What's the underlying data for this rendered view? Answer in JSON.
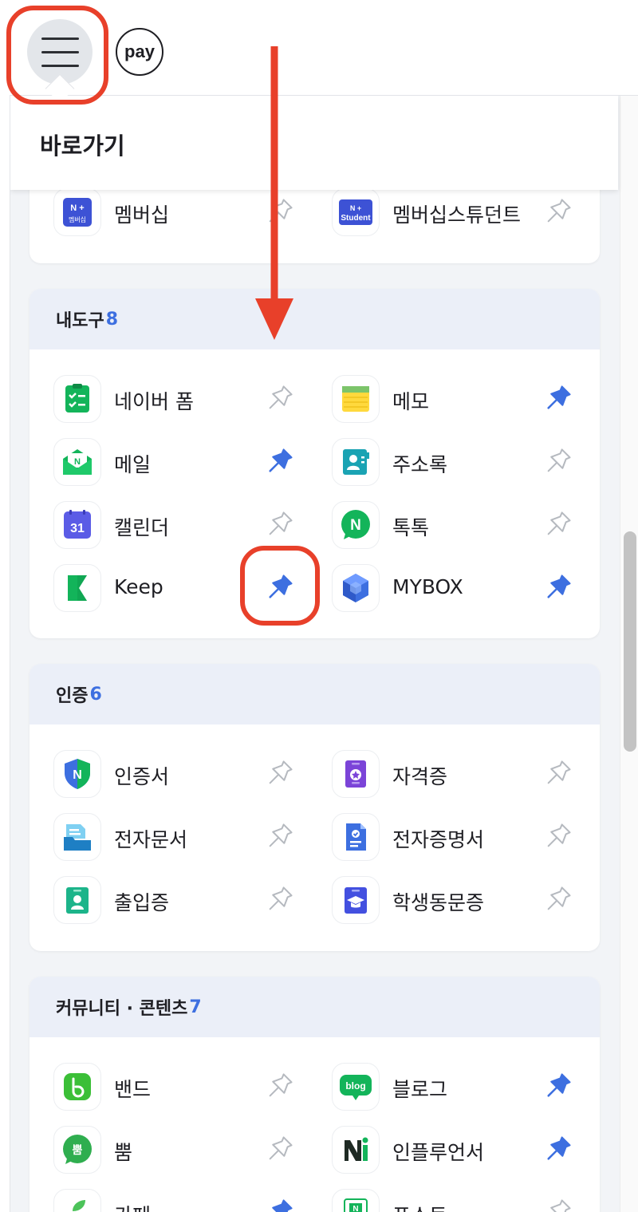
{
  "topbar": {
    "menu_icon": "hamburger-menu-icon",
    "pay_label": "pay"
  },
  "panel": {
    "title": "바로가기"
  },
  "colors": {
    "accent": "#3d6fe0",
    "highlight": "#e8402a",
    "section_bg": "#ebeff8"
  },
  "membership": {
    "items": [
      {
        "label": "멤버십",
        "icon": "membership-icon",
        "pinned": false
      },
      {
        "label": "멤버십스튜던트",
        "icon": "membership-student-icon",
        "pinned": false
      }
    ]
  },
  "tools": {
    "title": "내도구",
    "count": "8",
    "items": [
      {
        "label": "네이버 폼",
        "icon": "form-icon",
        "pinned": false
      },
      {
        "label": "메모",
        "icon": "memo-icon",
        "pinned": true
      },
      {
        "label": "메일",
        "icon": "mail-icon",
        "pinned": true
      },
      {
        "label": "주소록",
        "icon": "contacts-icon",
        "pinned": false
      },
      {
        "label": "캘린더",
        "icon": "calendar-icon",
        "pinned": false
      },
      {
        "label": "톡톡",
        "icon": "talktalk-icon",
        "pinned": false
      },
      {
        "label": "Keep",
        "icon": "keep-icon",
        "pinned": true
      },
      {
        "label": "MYBOX",
        "icon": "mybox-icon",
        "pinned": true
      }
    ]
  },
  "auth": {
    "title": "인증",
    "count": "6",
    "items": [
      {
        "label": "인증서",
        "icon": "certificate-icon",
        "pinned": false
      },
      {
        "label": "자격증",
        "icon": "license-icon",
        "pinned": false
      },
      {
        "label": "전자문서",
        "icon": "e-document-icon",
        "pinned": false
      },
      {
        "label": "전자증명서",
        "icon": "e-certificate-icon",
        "pinned": false
      },
      {
        "label": "출입증",
        "icon": "access-pass-icon",
        "pinned": false
      },
      {
        "label": "학생동문증",
        "icon": "student-alumni-id-icon",
        "pinned": false
      }
    ]
  },
  "community": {
    "title": "커뮤니티 · 콘텐츠",
    "count": "7",
    "items": [
      {
        "label": "밴드",
        "icon": "band-icon",
        "pinned": false
      },
      {
        "label": "블로그",
        "icon": "blog-icon",
        "pinned": true
      },
      {
        "label": "뿜",
        "icon": "ppum-icon",
        "pinned": false
      },
      {
        "label": "인플루언서",
        "icon": "influencer-icon",
        "pinned": true
      },
      {
        "label": "카페",
        "icon": "cafe-icon",
        "pinned": true
      },
      {
        "label": "포스트",
        "icon": "post-icon",
        "pinned": false
      }
    ]
  },
  "icon_glyphs": {
    "blog": "blog",
    "ppum": "뿜",
    "calendar": "31",
    "talk": "N",
    "membership_top": "N +",
    "membership_bottom": "멤버십",
    "student": "Student"
  }
}
